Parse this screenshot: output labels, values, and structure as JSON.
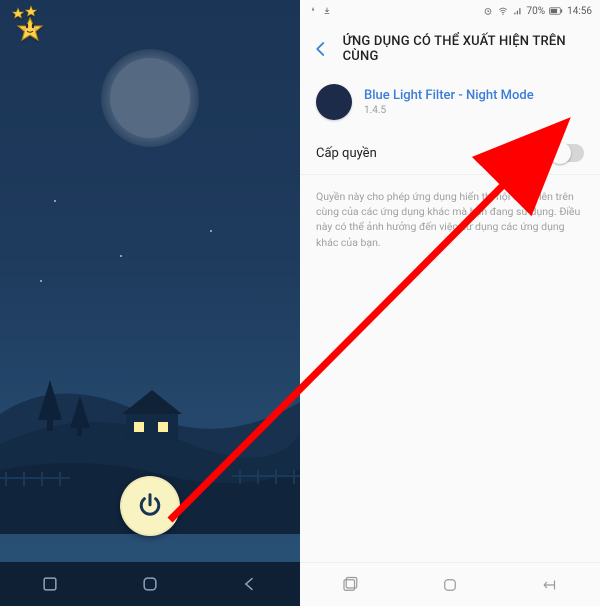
{
  "status": {
    "battery": "70%",
    "time": "14:56"
  },
  "header": {
    "title": "ỨNG DỤNG CÓ THỂ XUẤT HIỆN TRÊN CÙNG"
  },
  "app": {
    "name": "Blue Light Filter - Night Mode",
    "version": "1.4.5"
  },
  "permission": {
    "label": "Cấp quyền",
    "description": "Quyền này cho phép ứng dụng hiển thị nội dung lên trên cùng của các ứng dụng khác mà bạn đang sử dụng. Điều này có thể ảnh hưởng đến việc sử dụng các ứng dụng khác của bạn.",
    "enabled": false
  }
}
